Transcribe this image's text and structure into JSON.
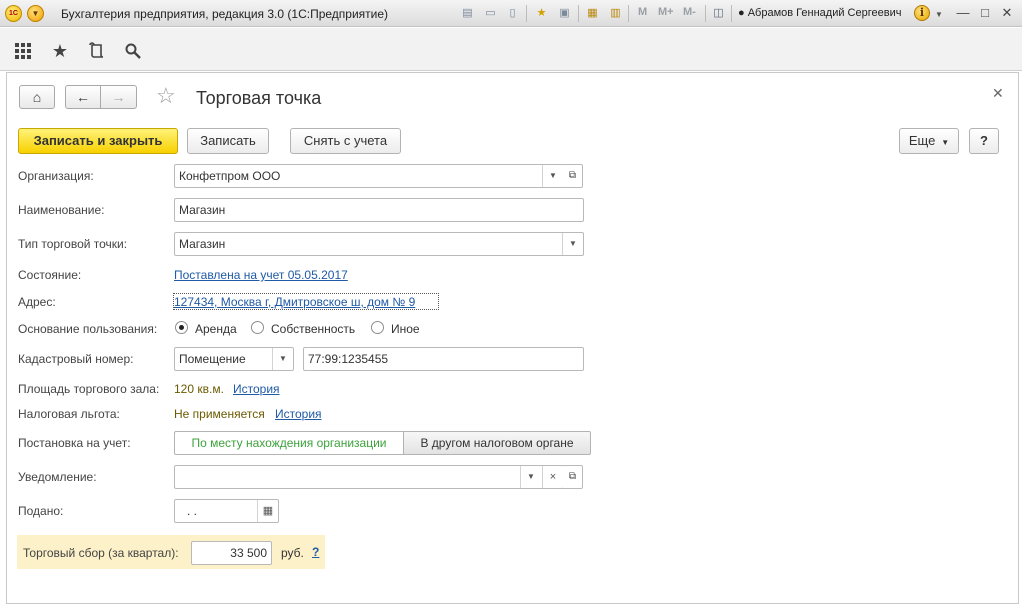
{
  "app": {
    "title": "Бухгалтерия предприятия, редакция 3.0 (1С:Предприятие)",
    "logo": "1С",
    "user": "Абрамов Геннадий Сергеевич",
    "memory": [
      "M",
      "M+",
      "M-"
    ]
  },
  "form": {
    "title": "Торговая точка",
    "buttons": {
      "save_close": "Записать и закрыть",
      "save": "Записать",
      "deregister": "Снять с учета",
      "more": "Еще",
      "help": "?"
    },
    "fields": {
      "organization": {
        "label": "Организация:",
        "value": "Конфетпром ООО"
      },
      "name": {
        "label": "Наименование:",
        "value": "Магазин"
      },
      "type": {
        "label": "Тип торговой точки:",
        "value": "Магазин"
      },
      "state": {
        "label": "Состояние:",
        "value": "Поставлена на учет 05.05.2017"
      },
      "address": {
        "label": "Адрес:",
        "value": "127434, Москва г, Дмитровское ш, дом № 9"
      },
      "basis": {
        "label": "Основание пользования:",
        "options": [
          "Аренда",
          "Собственность",
          "Иное"
        ],
        "selected": "Аренда"
      },
      "cadastral": {
        "label": "Кадастровый номер:",
        "kind": "Помещение",
        "value": "77:99:1235455"
      },
      "area": {
        "label": "Площадь торгового зала:",
        "value": "120 кв.м.",
        "history": "История"
      },
      "tax_benefit": {
        "label": "Налоговая льгота:",
        "value": "Не применяется",
        "history": "История"
      },
      "registration": {
        "label": "Постановка на учет:",
        "options": [
          "По месту нахождения организации",
          "В другом налоговом органе"
        ]
      },
      "notification": {
        "label": "Уведомление:",
        "value": ""
      },
      "submitted": {
        "label": "Подано:",
        "value": " .  ."
      },
      "fee": {
        "label": "Торговый сбор (за квартал):",
        "value": "33 500",
        "unit": "руб.",
        "help": "?"
      }
    }
  }
}
